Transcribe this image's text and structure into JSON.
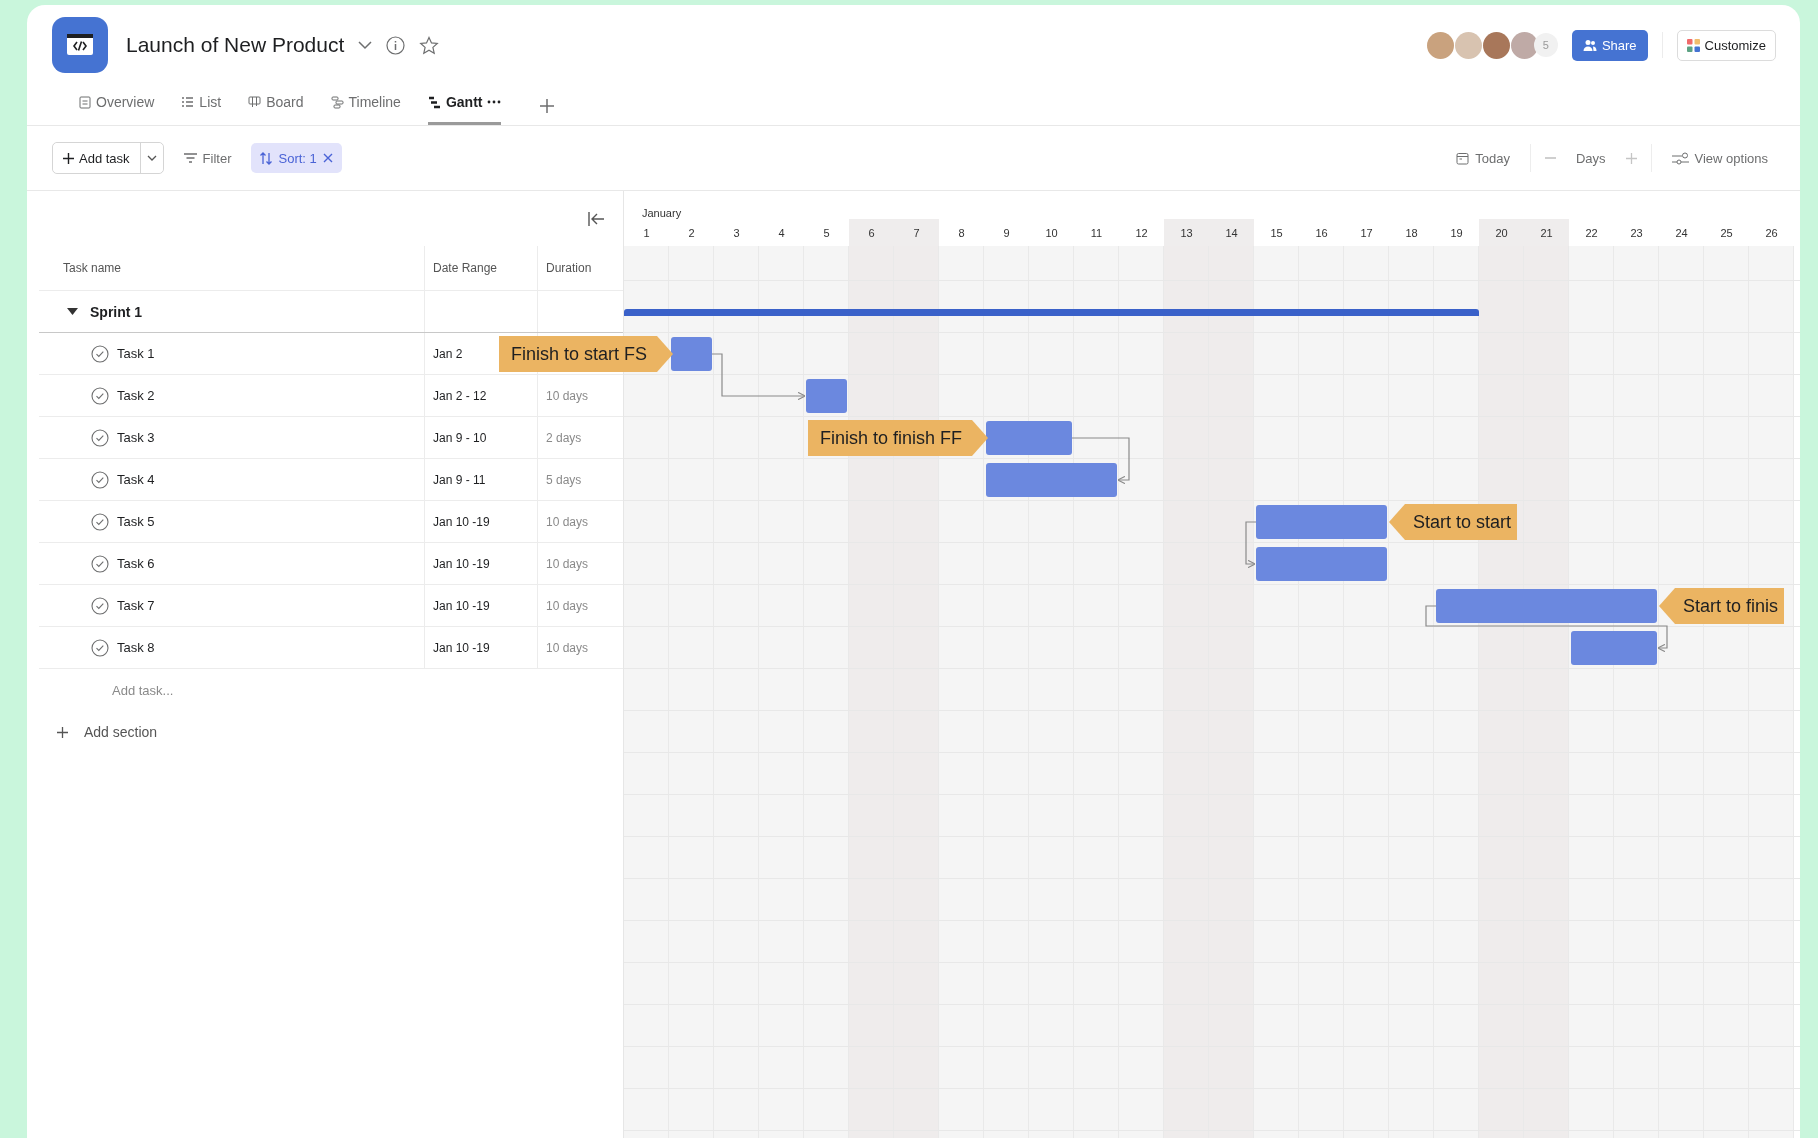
{
  "project": {
    "title": "Launch of New Product"
  },
  "tabs": [
    {
      "label": "Overview",
      "kind": "overview",
      "selected": false,
      "more_menu": false
    },
    {
      "label": "List",
      "kind": "list",
      "selected": false,
      "more_menu": false
    },
    {
      "label": "Board",
      "kind": "board",
      "selected": false,
      "more_menu": false
    },
    {
      "label": "Timeline",
      "kind": "timeline",
      "selected": false,
      "more_menu": false
    },
    {
      "label": "Gantt",
      "kind": "gantt",
      "selected": true,
      "more_menu": true
    }
  ],
  "members": {
    "avatars": [
      {
        "color": "#c9a27e"
      },
      {
        "color": "#d8c3b0"
      },
      {
        "color": "#a8775a"
      },
      {
        "color": "#bfaaa6"
      }
    ],
    "count": "5"
  },
  "share_button": "Share",
  "customize_button": "Customize",
  "toolbar": {
    "add_task": "Add task",
    "filter": "Filter",
    "sort": "Sort: 1",
    "today": "Today",
    "zoom": "Days",
    "view_options": "View options"
  },
  "table": {
    "columns": [
      "Task name",
      "Date Range",
      "Duration"
    ],
    "section": {
      "name": "Sprint 1",
      "expanded": true
    },
    "tasks": [
      {
        "name": "Task 1",
        "date_range": "Jan 2",
        "link": {
          "kind": "fs",
          "label": "Finish to start FS"
        }
      },
      {
        "name": "Task 2",
        "date_range": "Jan 2 - 12",
        "duration": "10 days"
      },
      {
        "name": "Task 3",
        "date_range": "Jan 9 - 10",
        "duration": "2 days",
        "link": {
          "kind": "ff",
          "label": "Finish to finish FF"
        }
      },
      {
        "name": "Task 4",
        "date_range": "Jan 9 - 11",
        "duration": "5 days"
      },
      {
        "name": "Task 5",
        "date_range": "Jan 10 -19",
        "duration": "10 days",
        "link": {
          "kind": "ss",
          "label": "Start to start"
        }
      },
      {
        "name": "Task 6",
        "date_range": "Jan 10 -19",
        "duration": "10 days"
      },
      {
        "name": "Task 7",
        "date_range": "Jan 10 -19",
        "duration": "10 days",
        "link": {
          "kind": "sf",
          "label": "Start to finis"
        }
      },
      {
        "name": "Task 8",
        "date_range": "Jan 10 -19",
        "duration": "10 days"
      }
    ],
    "add_task": "Add task...",
    "add_section": "Add section"
  },
  "timeline": {
    "month": "January",
    "days": [
      {
        "label": "1",
        "weekend": false
      },
      {
        "label": "2",
        "weekend": false
      },
      {
        "label": "3",
        "weekend": false
      },
      {
        "label": "4",
        "weekend": false
      },
      {
        "label": "5",
        "weekend": false
      },
      {
        "label": "6",
        "weekend": true
      },
      {
        "label": "7",
        "weekend": true
      },
      {
        "label": "8",
        "weekend": false
      },
      {
        "label": "9",
        "weekend": false
      },
      {
        "label": "10",
        "weekend": false
      },
      {
        "label": "11",
        "weekend": false
      },
      {
        "label": "12",
        "weekend": false
      },
      {
        "label": "13",
        "weekend": true
      },
      {
        "label": "14",
        "weekend": true
      },
      {
        "label": "15",
        "weekend": false
      },
      {
        "label": "16",
        "weekend": false
      },
      {
        "label": "17",
        "weekend": false
      },
      {
        "label": "18",
        "weekend": false
      },
      {
        "label": "19",
        "weekend": false
      },
      {
        "label": "20",
        "weekend": true
      },
      {
        "label": "21",
        "weekend": true
      },
      {
        "label": "22",
        "weekend": false
      },
      {
        "label": "23",
        "weekend": false
      },
      {
        "label": "24",
        "weekend": false
      },
      {
        "label": "25",
        "weekend": false
      },
      {
        "label": "26",
        "weekend": false
      }
    ]
  }
}
